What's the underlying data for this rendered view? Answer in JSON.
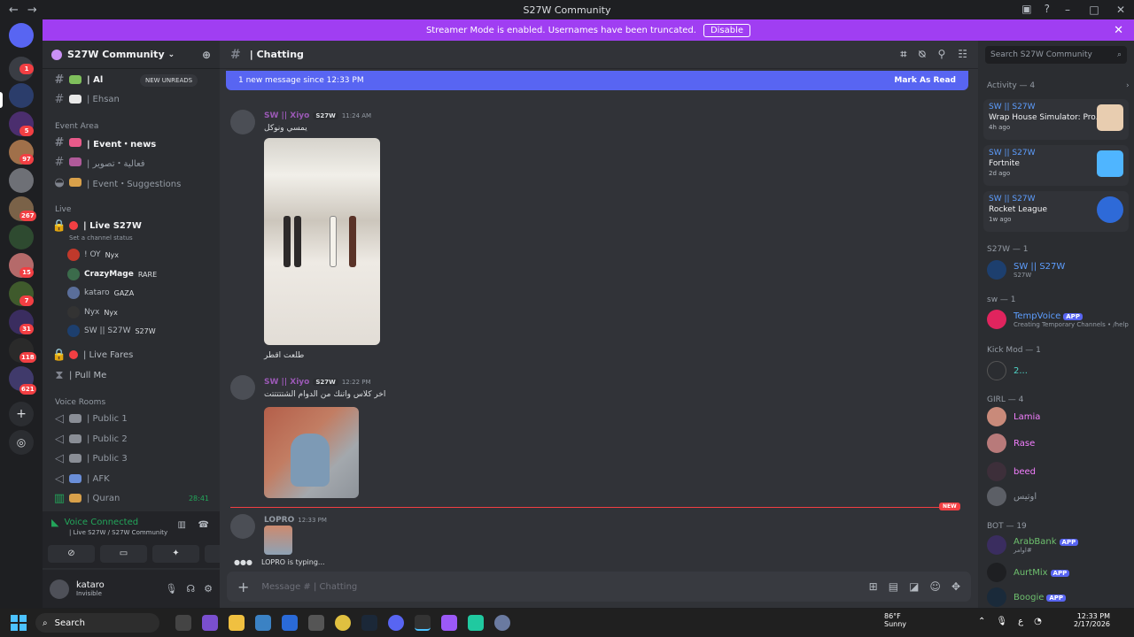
{
  "window": {
    "title": "S27W Community"
  },
  "banner": {
    "text": "Streamer Mode is enabled. Usernames have been truncated.",
    "disable": "Disable"
  },
  "guilds": {
    "badges": [
      "1",
      "5",
      "97",
      "267",
      "15",
      "7",
      "31",
      "118",
      "621"
    ]
  },
  "server": {
    "name": "S27W Community"
  },
  "sidebar": {
    "new_unreads": "NEW UNREADS",
    "top_channels": [
      "| Al",
      "| Ehsan"
    ],
    "event_cat": "Event Area",
    "event_channels": [
      "| Event・news",
      "| فعالية・تصوير",
      "| Event・Suggestions"
    ],
    "live_cat": "Live",
    "live_channel": "| Live S27W",
    "set_status": "Set a channel status",
    "live_members": [
      {
        "name": "! OY",
        "tag": "Nyx"
      },
      {
        "name": "CrazyMage",
        "tag": "RARE"
      },
      {
        "name": "kataro",
        "tag": "GAZA"
      },
      {
        "name": "Nyx",
        "tag": "Nyx"
      },
      {
        "name": "SW || S27W",
        "tag": "S27W"
      }
    ],
    "more_channels": [
      "| Live Fares",
      "| Pull Me"
    ],
    "voice_cat": "Voice Rooms",
    "voice_channels": [
      "| Public 1",
      "| Public 2",
      "| Public 3",
      "| AFK",
      "| Quran"
    ],
    "quran_time": "28:41"
  },
  "voice": {
    "title": "Voice Connected",
    "sub": "| Live S27W / S27W Community"
  },
  "user": {
    "name": "kataro",
    "status": "Invisible"
  },
  "chat": {
    "channel": "| Chatting",
    "new_bar": "1 new message since 12:33 PM",
    "mark_read": "Mark As Read",
    "msg1": {
      "name": "SW || Xiyo",
      "tag": "S27W",
      "time": "11:24 AM",
      "text": "يمسي ونوكل",
      "caption": "طلعت اقطر"
    },
    "msg2": {
      "name": "SW || Xiyo",
      "tag": "S27W",
      "time": "12:22 PM",
      "text": "اخر كلاس واتنك من الدوام الشتتتتتت"
    },
    "new_tag": "NEW",
    "msg3": {
      "name": "LOPRO",
      "time": "12:33 PM"
    },
    "typing": "LOPRO is typing...",
    "placeholder": "Message # | Chatting"
  },
  "members": {
    "search": "Search S27W Community",
    "activity_header": "Activity — 4",
    "activities": [
      {
        "name": "SW || S27W",
        "game": "Wrap House Simulator: Pro...",
        "time": "4h ago"
      },
      {
        "name": "SW || S27W",
        "game": "Fortnite",
        "time": "2d ago"
      },
      {
        "name": "SW || S27W",
        "game": "Rocket League",
        "time": "1w ago"
      }
    ],
    "groups": [
      {
        "header": "S27W — 1",
        "rows": [
          {
            "name": "SW || S27W",
            "sub": "S27W"
          }
        ]
      },
      {
        "header": "sw — 1",
        "rows": [
          {
            "name": "TempVoice",
            "sub": "Creating Temporary Channels • /help"
          }
        ]
      },
      {
        "header": "Kick Mod — 1",
        "rows": [
          {
            "name": "2...",
            "sub": ""
          }
        ]
      },
      {
        "header": "GIRL — 4",
        "rows": [
          {
            "name": "Lamia",
            "sub": ""
          },
          {
            "name": "Rase",
            "sub": ""
          },
          {
            "name": "beed",
            "sub": ""
          },
          {
            "name": "اوتيس",
            "sub": ""
          }
        ]
      },
      {
        "header": "BOT — 19",
        "rows": [
          {
            "name": "ArabBank",
            "sub": "اوامر#"
          },
          {
            "name": "AurtMix",
            "sub": ""
          },
          {
            "name": "Boogie",
            "sub": ""
          }
        ]
      }
    ],
    "app_label": "APP"
  },
  "taskbar": {
    "search": "Search",
    "temp": "86°F",
    "weather": "Sunny",
    "time": "12:33 PM",
    "date": "2/17/2026",
    "lang": "ع"
  }
}
